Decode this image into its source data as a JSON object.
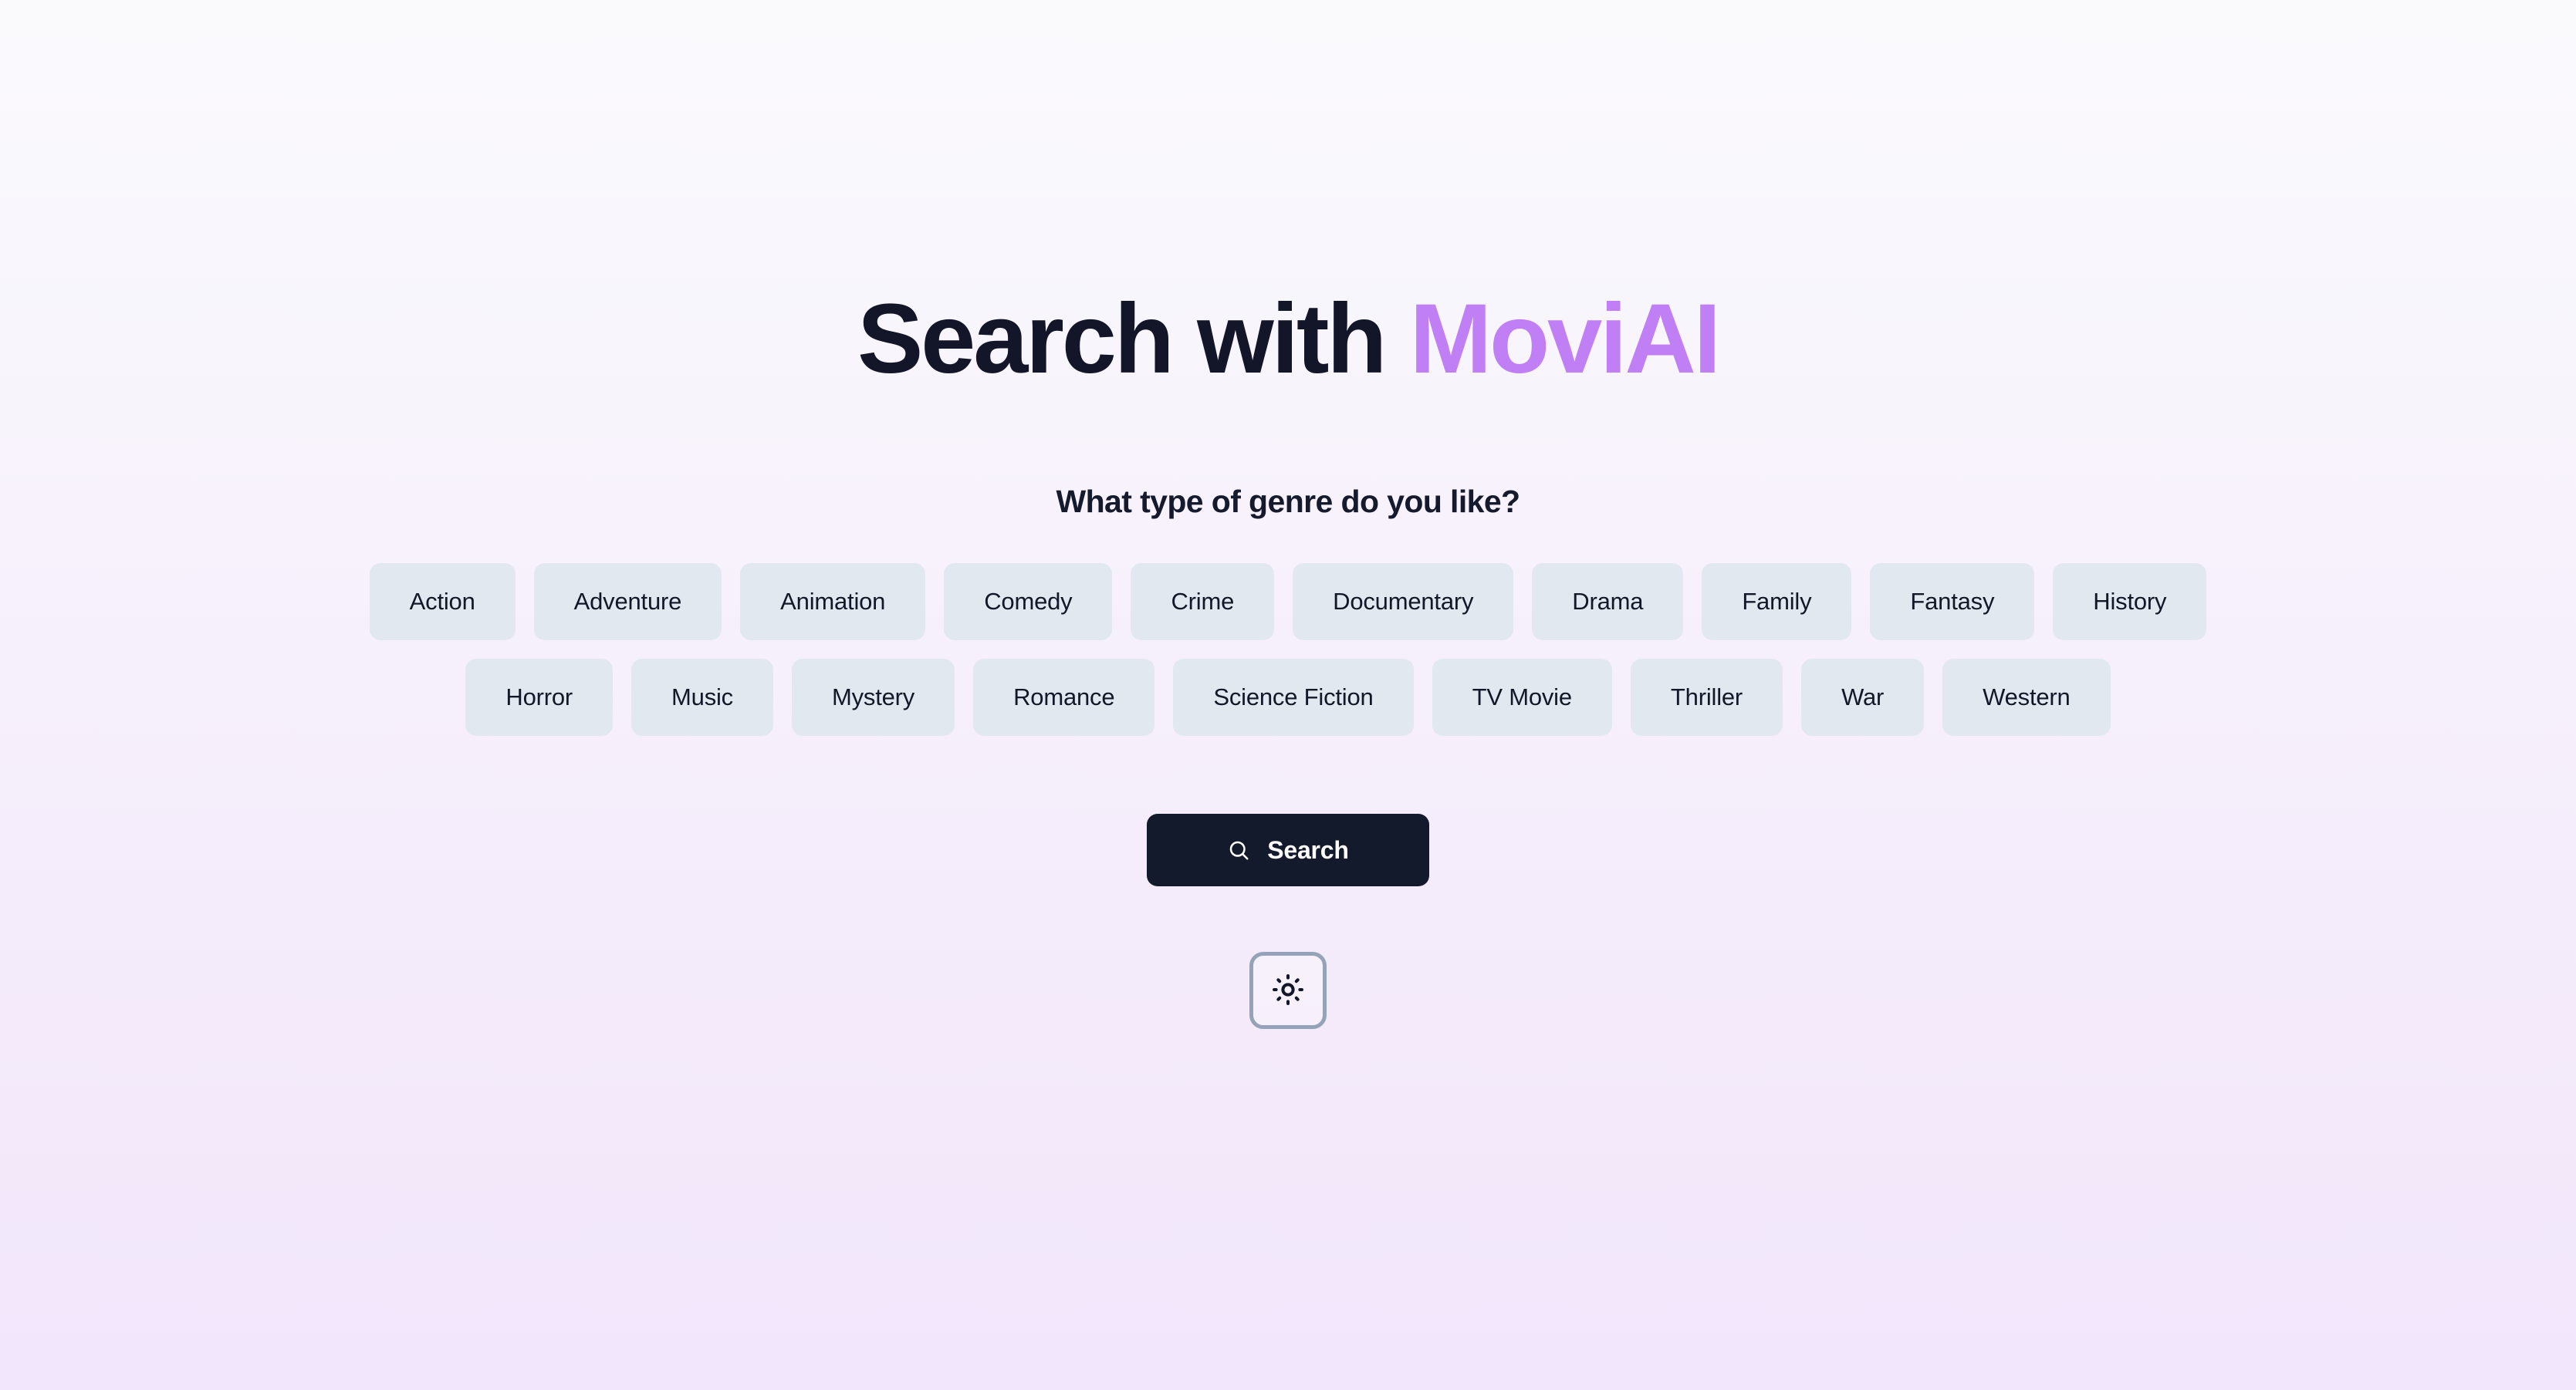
{
  "hero": {
    "title_prefix": "Search with ",
    "title_accent": "MoviAI",
    "subtitle": "What type of genre do you like?"
  },
  "genres": {
    "row1": [
      "Action",
      "Adventure",
      "Animation",
      "Comedy",
      "Crime",
      "Documentary",
      "Drama",
      "Family",
      "Fantasy",
      "History"
    ],
    "row2": [
      "Horror",
      "Music",
      "Mystery",
      "Romance",
      "Science Fiction",
      "TV Movie",
      "Thriller",
      "War",
      "Western"
    ]
  },
  "actions": {
    "search_label": "Search",
    "search_icon": "search-icon",
    "theme_toggle_icon": "sun-icon"
  },
  "colors": {
    "accent_purple": "#c17ff5",
    "title_dark": "#131629",
    "chip_bg": "#e2e8f0",
    "chip_text": "#111827",
    "search_btn_bg": "#131a2b",
    "search_btn_text": "#ffffff",
    "toggle_border": "#94a3b8",
    "bg_top": "#fafafd",
    "bg_bottom": "#f2e6fc"
  }
}
